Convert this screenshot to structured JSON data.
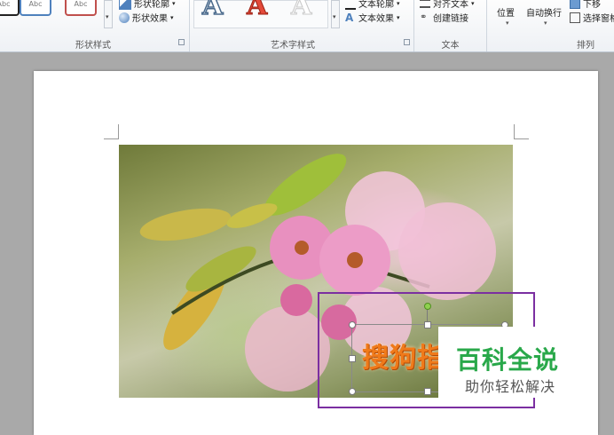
{
  "ribbon": {
    "groups": {
      "shape_styles": "形状样式",
      "wordart_styles": "艺术字样式",
      "text": "文本",
      "arrange": "排列"
    },
    "shape_styles": {
      "sample_1": "Abc",
      "sample_2": "Abc",
      "shape_outline": "形状轮廓",
      "shape_effects": "形状效果"
    },
    "wordart": {
      "letter": "A",
      "text_outline": "文本轮廓",
      "text_effects": "文本效果"
    },
    "text_group": {
      "align_text": "对齐文本",
      "create_link": "创建链接"
    },
    "arrange_group": {
      "position": "位置",
      "wrap_text": "自动换行",
      "send_backward": "下移",
      "selection_pane": "选择窗格"
    }
  },
  "document": {
    "textbox_text": "搜狗指南"
  },
  "watermark": {
    "title": "百科全说",
    "subtitle": "助你轻松解决"
  },
  "colors": {
    "selection_border": "#7b2fa1",
    "wordart_orange": "#f07a1a",
    "watermark_green": "#29a84a"
  }
}
